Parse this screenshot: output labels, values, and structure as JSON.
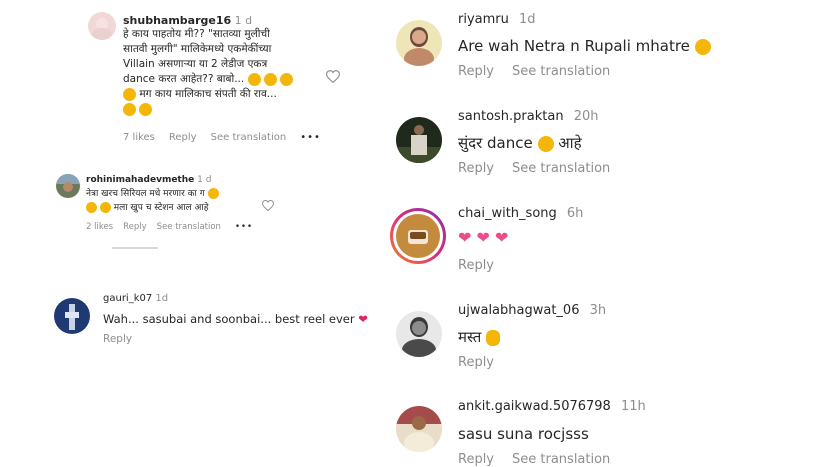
{
  "left": {
    "c1": {
      "username": "shubhambarge16",
      "time": "1 d",
      "lines": [
        "हे काय पाहतोय मी?? \"सातव्या मुलीची",
        "सातवी मुलगी\" मालिकेमध्ये एकमेकींच्या",
        "Villain असणाऱ्या या 2 लेडीज एकत्र",
        "dance करत आहेत?? बाबो...",
        "मग काय मालिकाच संपती की राव...",
        ""
      ],
      "likes": "7 likes",
      "reply": "Reply",
      "see_translation": "See translation",
      "more": "•••"
    },
    "c2": {
      "username": "rohinimahadevmethe",
      "time": "1 d",
      "line1": "नेत्रा खरच सिरियल मधे मरणार का ग",
      "line2": "मला खुप च स्टेशन आल आहे",
      "likes": "2 likes",
      "reply": "Reply",
      "see_translation": "See translation",
      "more": "•••"
    },
    "c3": {
      "username": "gauri_k07",
      "time": "1d",
      "text": "Wah... sasubai and soonbai... best reel ever",
      "reply": "Reply"
    }
  },
  "right": {
    "r1": {
      "username": "riyamru",
      "time": "1d",
      "text": "Are wah Netra n Rupali mhatre",
      "reply": "Reply",
      "see_translation": "See translation"
    },
    "r2": {
      "username": "santosh.praktan",
      "time": "20h",
      "text": "सुंदर dance",
      "text2": "आहे",
      "reply": "Reply",
      "see_translation": "See translation"
    },
    "r3": {
      "username": "chai_with_song",
      "time": "6h",
      "reply": "Reply"
    },
    "r4": {
      "username": "ujwalabhagwat_06",
      "time": "3h",
      "text": "मस्त",
      "reply": "Reply"
    },
    "r5": {
      "username": "ankit.gaikwad.5076798",
      "time": "11h",
      "text": "sasu suna rocjsss",
      "reply": "Reply",
      "see_translation": "See translation"
    }
  },
  "colors": {
    "text": "#262626",
    "meta": "#8e8e8e",
    "heart": "#e0245e",
    "story_ring": "#c13584"
  }
}
